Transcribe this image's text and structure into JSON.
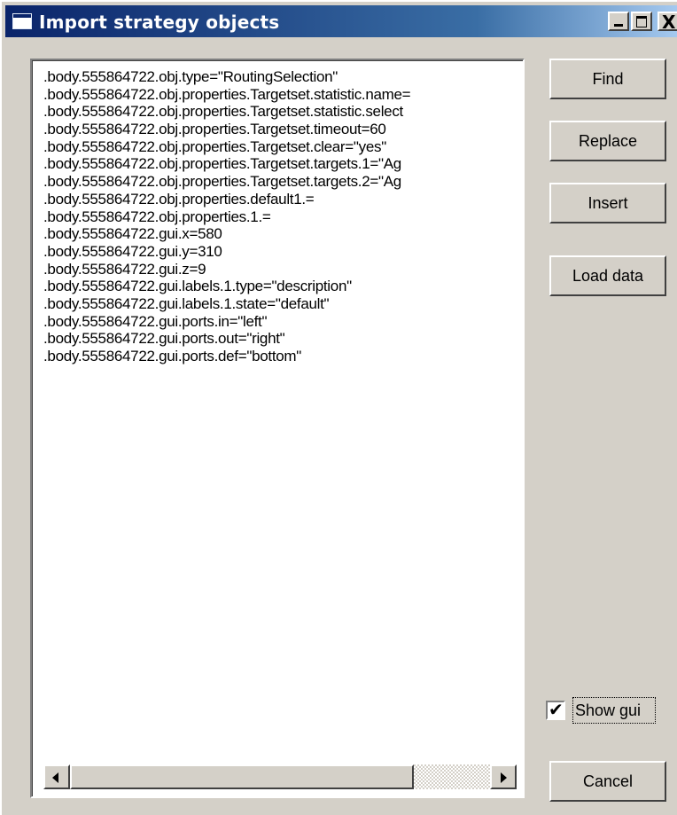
{
  "window": {
    "title": "Import strategy objects",
    "close_glyph": "X"
  },
  "listbox": {
    "lines": [
      ".body.555864722.obj.type=\"RoutingSelection\"",
      ".body.555864722.obj.properties.Targetset.statistic.name=",
      ".body.555864722.obj.properties.Targetset.statistic.select",
      ".body.555864722.obj.properties.Targetset.timeout=60",
      ".body.555864722.obj.properties.Targetset.clear=\"yes\"",
      ".body.555864722.obj.properties.Targetset.targets.1=\"Ag",
      ".body.555864722.obj.properties.Targetset.targets.2=\"Ag",
      ".body.555864722.obj.properties.default1.=",
      ".body.555864722.obj.properties.1.=",
      ".body.555864722.gui.x=580",
      ".body.555864722.gui.y=310",
      ".body.555864722.gui.z=9",
      ".body.555864722.gui.labels.1.type=\"description\"",
      ".body.555864722.gui.labels.1.state=\"default\"",
      ".body.555864722.gui.ports.in=\"left\"",
      ".body.555864722.gui.ports.out=\"right\"",
      ".body.555864722.gui.ports.def=\"bottom\""
    ]
  },
  "buttons": {
    "find": "Find",
    "replace": "Replace",
    "insert": "Insert",
    "load_data": "Load data",
    "cancel": "Cancel"
  },
  "show_gui": {
    "label": "Show gui",
    "checked": true
  },
  "icons": {
    "title": "window-app-icon",
    "checkmark": "✔"
  }
}
